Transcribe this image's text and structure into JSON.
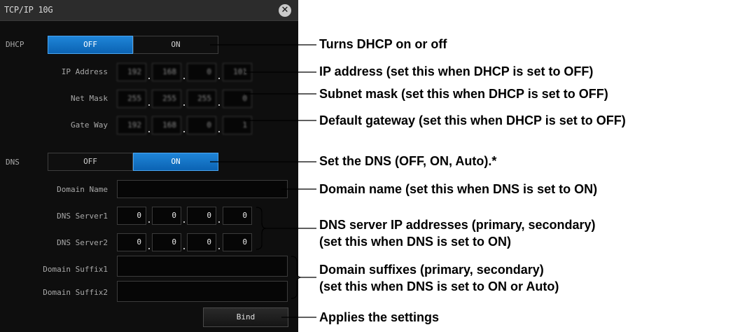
{
  "dialog": {
    "title": "TCP/IP 10G",
    "close_symbol": "✕",
    "dhcp": {
      "label": "DHCP",
      "off": "OFF",
      "on": "ON",
      "selected": "OFF"
    },
    "ip_address": {
      "label": "IP Address",
      "octets": [
        "192",
        "168",
        "0",
        "101"
      ]
    },
    "net_mask": {
      "label": "Net Mask",
      "octets": [
        "255",
        "255",
        "255",
        "0"
      ]
    },
    "gate_way": {
      "label": "Gate Way",
      "octets": [
        "192",
        "168",
        "0",
        "1"
      ]
    },
    "dns": {
      "label": "DNS",
      "off": "OFF",
      "on": "ON",
      "selected": "ON"
    },
    "domain_name": {
      "label": "Domain Name",
      "value": ""
    },
    "dns_server1": {
      "label": "DNS Server1",
      "octets": [
        "0",
        "0",
        "0",
        "0"
      ]
    },
    "dns_server2": {
      "label": "DNS Server2",
      "octets": [
        "0",
        "0",
        "0",
        "0"
      ]
    },
    "domain_suffix1": {
      "label": "Domain Suffix1",
      "value": ""
    },
    "domain_suffix2": {
      "label": "Domain Suffix2",
      "value": ""
    },
    "bind_label": "Bind"
  },
  "annotations": {
    "dhcp": "Turns DHCP on or off",
    "ip": "IP address (set this when DHCP is set to OFF)",
    "mask": "Subnet mask (set this when DHCP is set to OFF)",
    "gateway": "Default gateway (set this when DHCP is set to OFF)",
    "dns": "Set the DNS (OFF, ON, Auto).*",
    "domain_name": "Domain name (set this when DNS is set to ON)",
    "dns_servers_line1": "DNS server IP addresses (primary, secondary)",
    "dns_servers_line2": "(set this when DNS is set to ON)",
    "suffixes_line1": "Domain suffixes (primary, secondary)",
    "suffixes_line2": "(set this when DNS is set to ON or Auto)",
    "bind": "Applies the settings"
  },
  "colors": {
    "dialog_bg": "#0e0e0e",
    "selected_button": "#0b63b3",
    "annotation_text": "#000000"
  }
}
